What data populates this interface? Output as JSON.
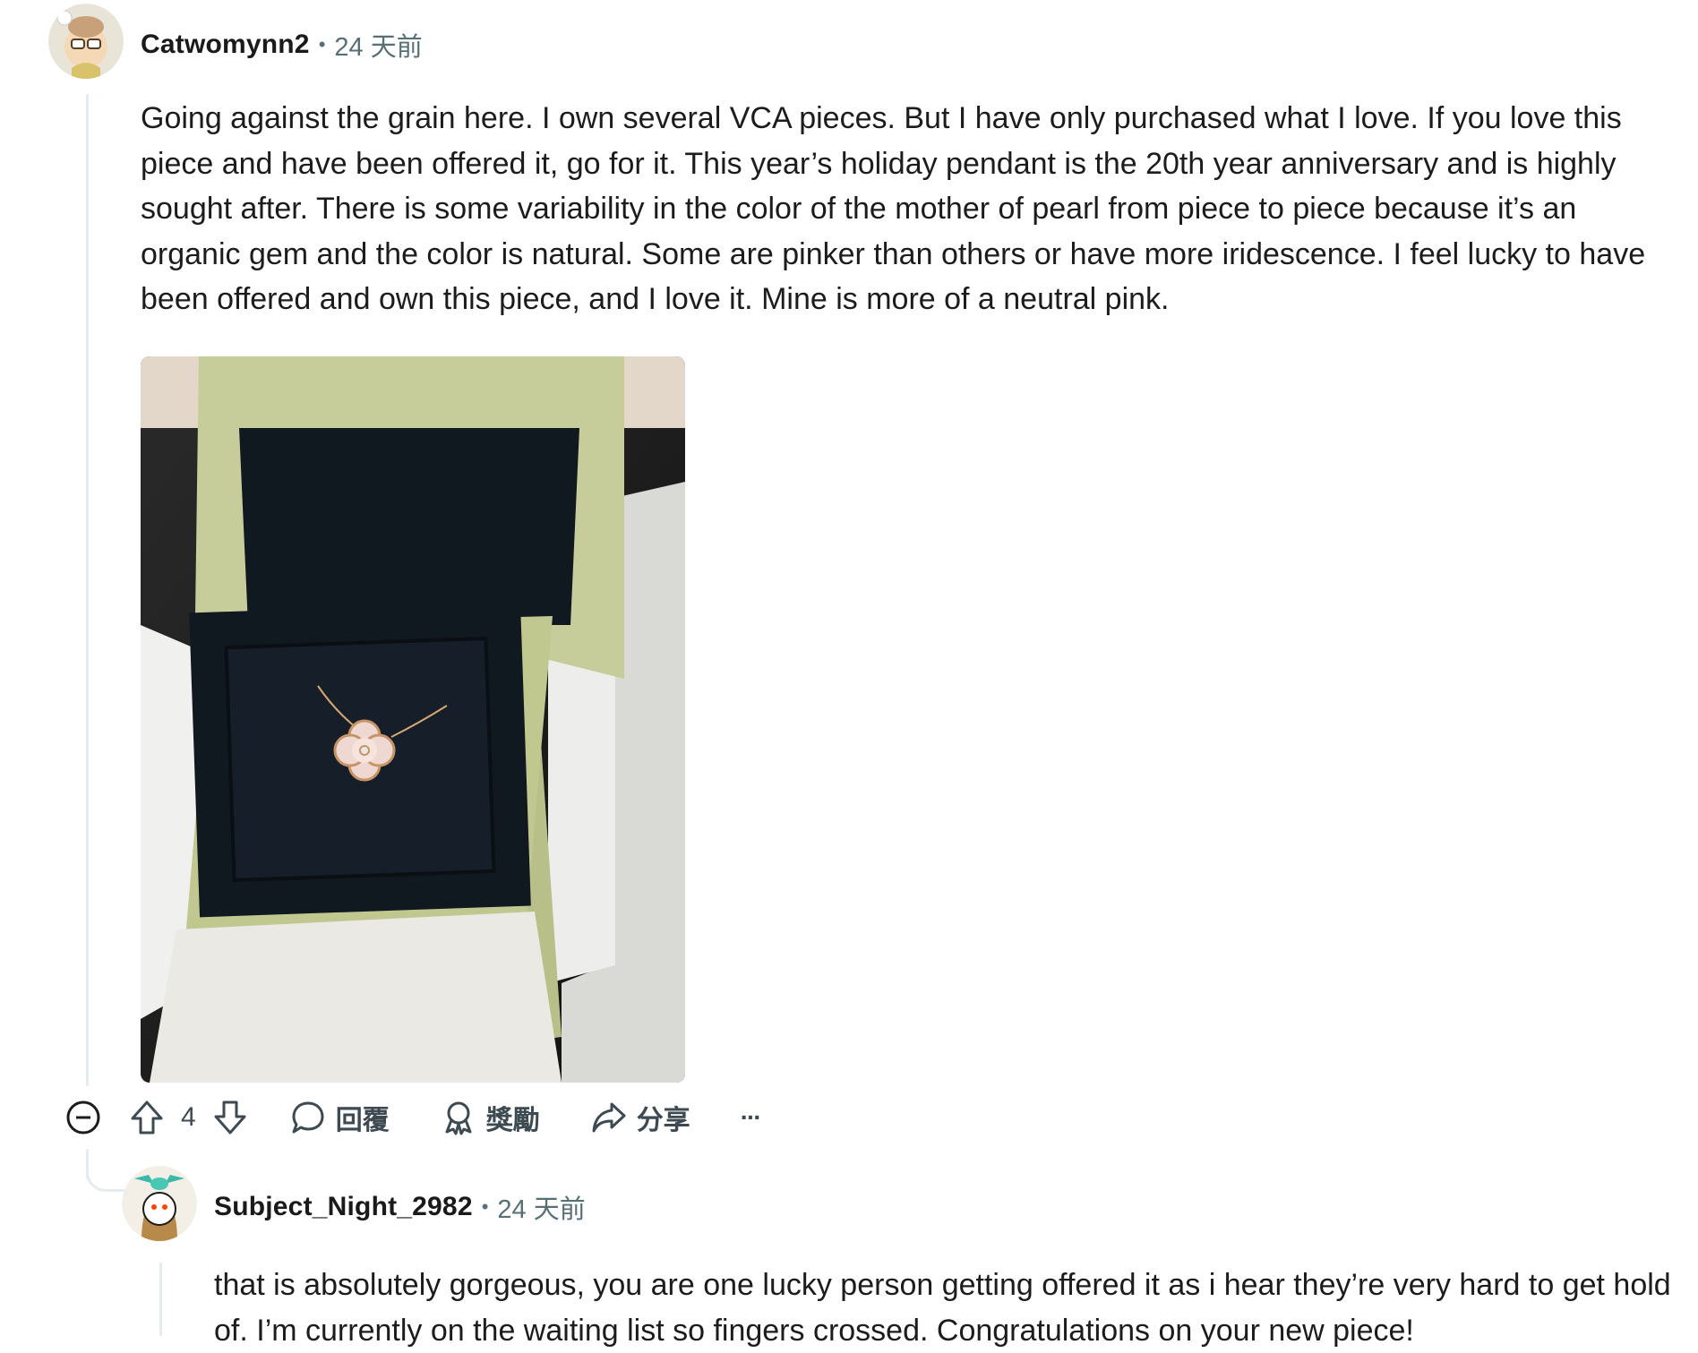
{
  "comments": [
    {
      "author": "Catwomynn2",
      "separator": "•",
      "time": "24 天前",
      "body": "Going against the grain here. I own several VCA pieces. But I have only purchased what I love. If you love this piece and have been offered it, go for it. This year’s holiday pendant is the 20th year anniversary and is highly sought after. There is some variability in the color of the mother of pearl from piece to piece because it’s an organic gem and the color is natural. Some are pinker than others or have more iridescence. I feel lucky to have been offered and own this piece, and I love it. Mine is more of a neutral pink.",
      "image_alt": "Van Cleef & Arpels holiday pendant in a green box",
      "actions": {
        "vote_count": "4",
        "reply": "回覆",
        "award": "獎勵",
        "share": "分享",
        "more": "···"
      }
    },
    {
      "author": "Subject_Night_2982",
      "separator": "•",
      "time": "24 天前",
      "body": "that is absolutely gorgeous, you are one lucky person getting offered it as i hear they’re very hard to get hold of. I’m currently on the waiting list so fingers crossed. Congratulations on your new piece!"
    }
  ],
  "icons": {
    "collapse": "collapse-icon",
    "upvote": "upvote-icon",
    "downvote": "downvote-icon",
    "reply": "comment-bubble-icon",
    "award": "award-icon",
    "share": "share-icon",
    "more": "more-icon"
  },
  "colors": {
    "thread_line": "#e5ebee",
    "meta_text": "#576f76",
    "action_text": "#3d4a52"
  }
}
